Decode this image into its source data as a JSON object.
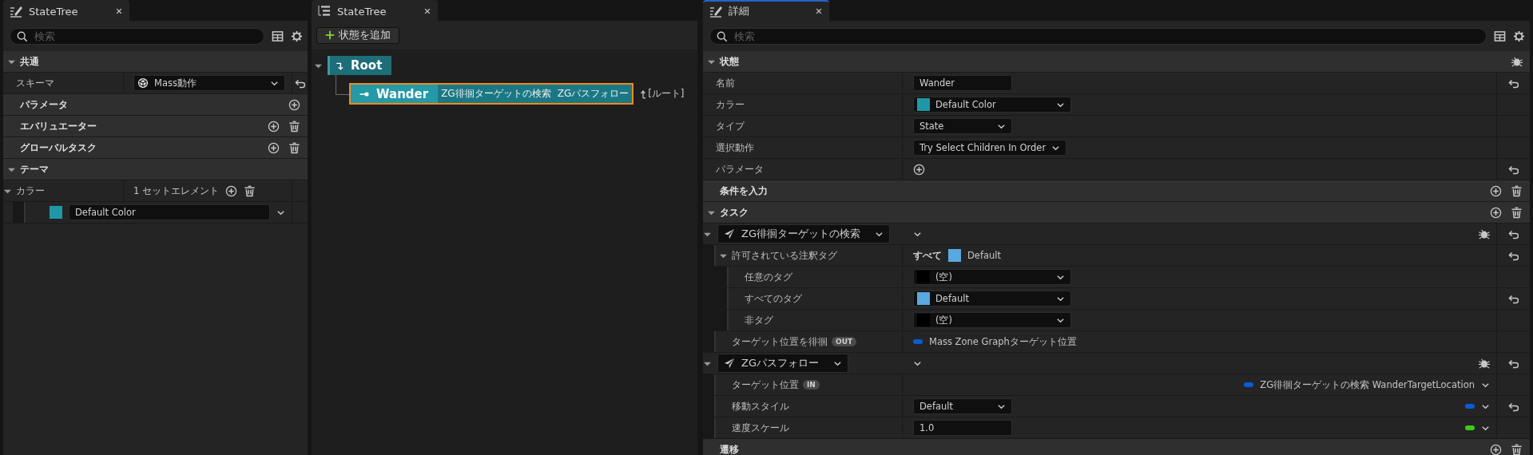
{
  "outline_panel": {
    "tab": {
      "title": "StateTree",
      "focused": false
    },
    "search": {
      "placeholder": "検索"
    },
    "rows": [
      {
        "kind": "section",
        "label": "共通",
        "expanded": true,
        "children": [
          {
            "kind": "property",
            "label": "スキーマ",
            "value": {
              "kind": "asset_combo",
              "text": "Mass動作"
            },
            "reset": true
          }
        ]
      },
      {
        "kind": "category",
        "label": "パラメータ",
        "add": true
      },
      {
        "kind": "category",
        "label": "エバリュエーター",
        "add": true,
        "delete": true
      },
      {
        "kind": "category",
        "label": "グローバルタスク",
        "add": true,
        "delete": true
      },
      {
        "kind": "section",
        "label": "テーマ",
        "expanded": true,
        "children": [
          {
            "kind": "property",
            "label": "カラー",
            "expanded": true,
            "value": {
              "kind": "array",
              "text": "1 セットエレメント"
            },
            "children": [
              {
                "kind": "element",
                "value": {
                  "kind": "color_select",
                  "text": "Default Color",
                  "color": "#1f97a6"
                }
              }
            ]
          }
        ]
      }
    ]
  },
  "tree_panel": {
    "tab": {
      "title": "StateTree",
      "focused": false
    },
    "add_button": {
      "label": "状態を追加"
    },
    "states": [
      {
        "name": "Root",
        "expanded": true,
        "selected": false,
        "children": [
          {
            "name": "Wander",
            "selected": true,
            "tasks": [
              "ZG徘徊ターゲットの検索",
              "ZGパスフォロー"
            ],
            "transition": "[ルート]"
          }
        ]
      }
    ]
  },
  "details_panel": {
    "tab": {
      "title": "詳細",
      "focused": true
    },
    "search": {
      "placeholder": "検索"
    },
    "rows": [
      {
        "kind": "section",
        "label": "状態",
        "expanded": true,
        "debug": true,
        "children": [
          {
            "kind": "property",
            "label": "名前",
            "value": {
              "kind": "text",
              "text": "Wander"
            },
            "reset": true
          },
          {
            "kind": "property",
            "label": "カラー",
            "value": {
              "kind": "color_combo",
              "text": "Default Color",
              "color": "#1f97a6"
            }
          },
          {
            "kind": "property",
            "label": "タイプ",
            "value": {
              "kind": "combo",
              "text": "State"
            }
          },
          {
            "kind": "property",
            "label": "選択動作",
            "value": {
              "kind": "combo",
              "text": "Try Select Children In Order"
            }
          },
          {
            "kind": "property",
            "label": "パラメータ",
            "value": {
              "kind": "add"
            },
            "reset": true
          }
        ]
      },
      {
        "kind": "category",
        "label": "条件を入力",
        "add": true,
        "delete": true
      },
      {
        "kind": "section",
        "label": "タスク",
        "expanded": true,
        "add": true,
        "delete": true,
        "children": [
          {
            "kind": "task",
            "label": "ZG徘徊ターゲットの検索",
            "expanded": true,
            "debug": true,
            "reset": true,
            "children": [
              {
                "kind": "property",
                "label": "許可されている注釈タグ",
                "expanded": true,
                "value": {
                  "kind": "tag_summary",
                  "prefix": "すべて",
                  "text": "Default",
                  "color": "#5aa8e0"
                },
                "reset": true,
                "children": [
                  {
                    "kind": "property",
                    "label": "任意のタグ",
                    "value": {
                      "kind": "color_combo",
                      "text": "(空)",
                      "color": "#000000"
                    }
                  },
                  {
                    "kind": "property",
                    "label": "すべてのタグ",
                    "value": {
                      "kind": "color_combo",
                      "text": "Default",
                      "color": "#5aa8e0"
                    },
                    "reset": true
                  },
                  {
                    "kind": "property",
                    "label": "非タグ",
                    "value": {
                      "kind": "color_combo",
                      "text": "(空)",
                      "color": "#000000"
                    }
                  }
                ]
              },
              {
                "kind": "property",
                "label": "ターゲット位置を徘徊",
                "badge": "OUT",
                "value": {
                  "kind": "binding",
                  "text": "Mass Zone Graphターゲット位置",
                  "color": "#0a5bd6"
                }
              }
            ]
          },
          {
            "kind": "task",
            "label": "ZGパスフォロー",
            "expanded": true,
            "debug": true,
            "reset": true,
            "children": [
              {
                "kind": "property",
                "label": "ターゲット位置",
                "badge": "IN",
                "value": {
                  "kind": "binding_select",
                  "text": "ZG徘徊ターゲットの検索 WanderTargetLocation",
                  "color": "#0a5bd6"
                }
              },
              {
                "kind": "property",
                "label": "移動スタイル",
                "value": {
                  "kind": "combo",
                  "text": "Default"
                },
                "pin": {
                  "color": "#0a5bd6"
                },
                "reset": true
              },
              {
                "kind": "property",
                "label": "速度スケール",
                "value": {
                  "kind": "text",
                  "text": "1.0"
                },
                "pin": {
                  "color": "#3dcc1a"
                }
              }
            ]
          }
        ]
      },
      {
        "kind": "category",
        "label": "遷移",
        "add": true,
        "delete": true
      }
    ]
  }
}
